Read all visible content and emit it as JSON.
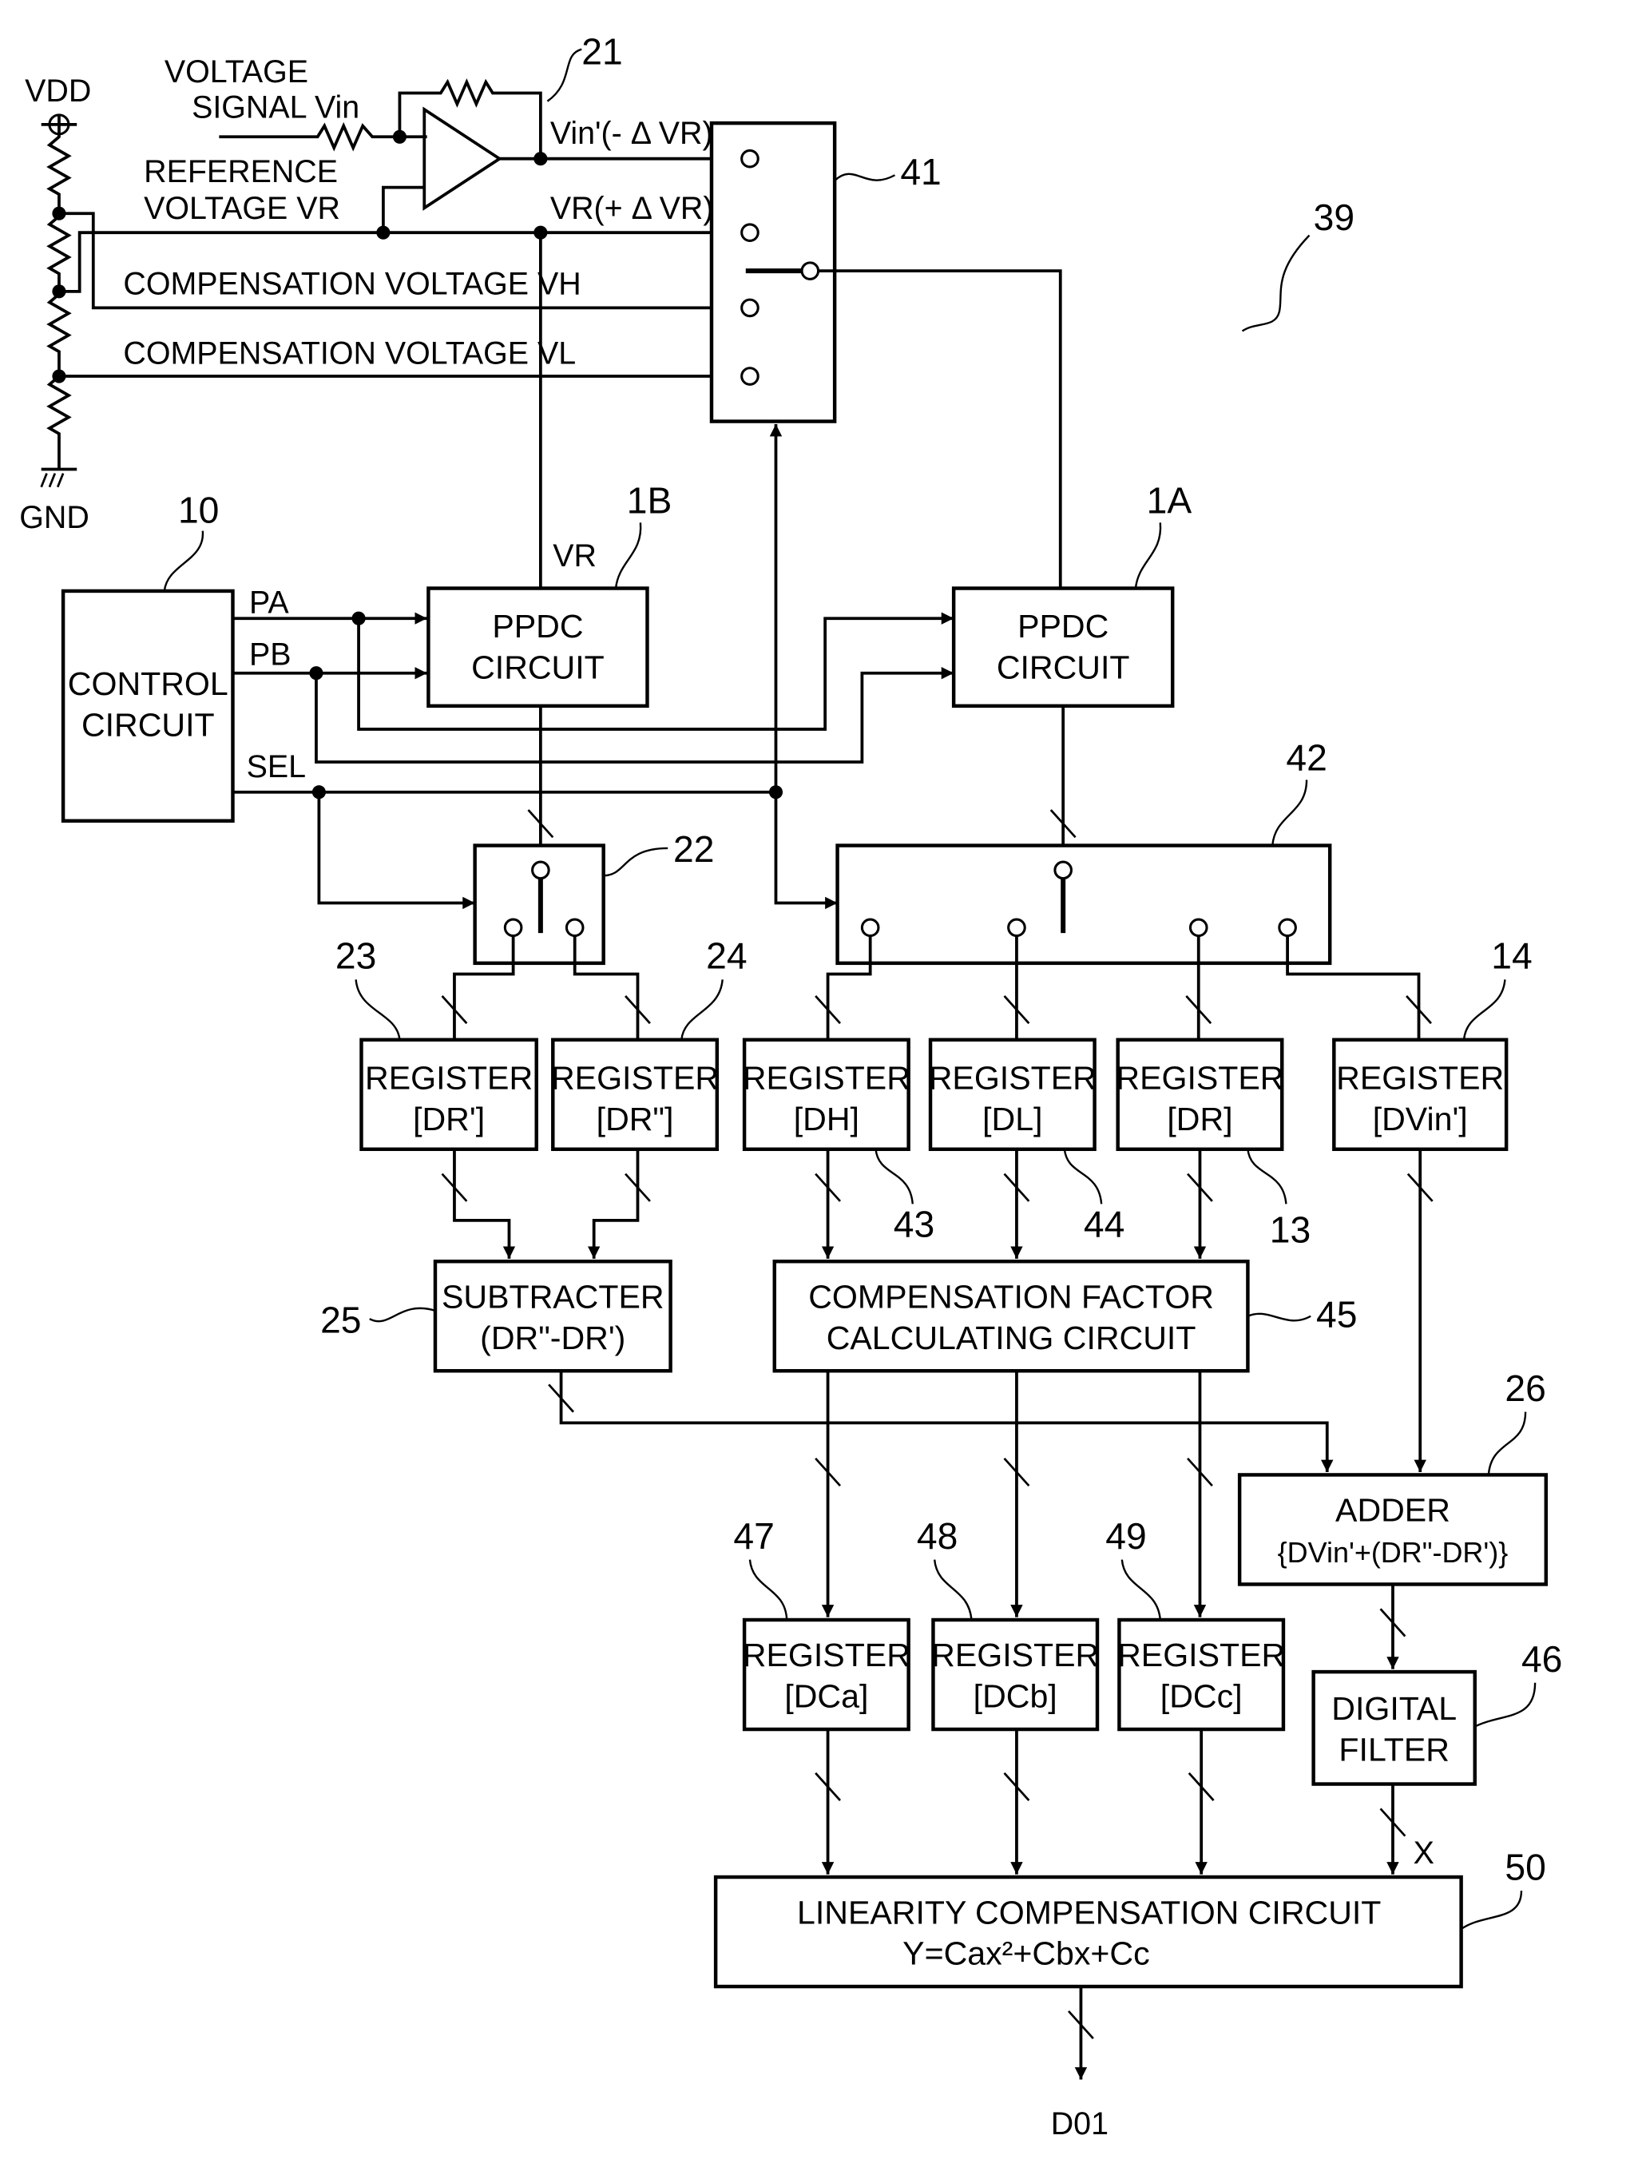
{
  "figure": {
    "figure_ref": "39",
    "power": {
      "vdd_label": "VDD",
      "gnd_label": "GND"
    },
    "signals": {
      "voltage_signal_line1": "VOLTAGE",
      "voltage_signal_line2": "SIGNAL Vin",
      "reference_voltage_line1": "REFERENCE",
      "reference_voltage_line2": "VOLTAGE VR",
      "compensation_vh": "COMPENSATION VOLTAGE VH",
      "compensation_vl": "COMPENSATION VOLTAGE VL",
      "vin_prime": "Vin'(- Δ VR)",
      "vr_plus": "VR(+ Δ VR)",
      "vr": "VR",
      "pa": "PA",
      "pb": "PB",
      "sel": "SEL",
      "x": "X",
      "output": "D01"
    },
    "blocks": {
      "amplifier": {
        "ref": "21"
      },
      "selector_41": {
        "ref": "41"
      },
      "control": {
        "ref": "10",
        "line1": "CONTROL",
        "line2": "CIRCUIT"
      },
      "ppdc_1b": {
        "ref": "1B",
        "line1": "PPDC",
        "line2": "CIRCUIT"
      },
      "ppdc_1a": {
        "ref": "1A",
        "line1": "PPDC",
        "line2": "CIRCUIT"
      },
      "switch_22": {
        "ref": "22"
      },
      "switch_42": {
        "ref": "42"
      },
      "reg_23": {
        "ref": "23",
        "line1": "REGISTER",
        "line2": "[DR']"
      },
      "reg_24": {
        "ref": "24",
        "line1": "REGISTER",
        "line2": "[DR\"]"
      },
      "reg_43": {
        "ref": "43",
        "line1": "REGISTER",
        "line2": "[DH]"
      },
      "reg_44": {
        "ref": "44",
        "line1": "REGISTER",
        "line2": "[DL]"
      },
      "reg_13": {
        "ref": "13",
        "line1": "REGISTER",
        "line2": "[DR]"
      },
      "reg_14": {
        "ref": "14",
        "line1": "REGISTER",
        "line2": "[DVin']"
      },
      "subtracter": {
        "ref": "25",
        "line1": "SUBTRACTER",
        "line2": "(DR\"-DR')"
      },
      "comp_factor": {
        "ref": "45",
        "line1": "COMPENSATION FACTOR",
        "line2": "CALCULATING CIRCUIT"
      },
      "adder": {
        "ref": "26",
        "line1": "ADDER",
        "line2": "{DVin'+(DR\"-DR')}"
      },
      "reg_47": {
        "ref": "47",
        "line1": "REGISTER",
        "line2": "[DCa]"
      },
      "reg_48": {
        "ref": "48",
        "line1": "REGISTER",
        "line2": "[DCb]"
      },
      "reg_49": {
        "ref": "49",
        "line1": "REGISTER",
        "line2": "[DCc]"
      },
      "digital_filter": {
        "ref": "46",
        "line1": "DIGITAL",
        "line2": "FILTER"
      },
      "linearity": {
        "ref": "50",
        "line1": "LINEARITY COMPENSATION CIRCUIT",
        "line2": "Y=Cax²+Cbx+Cc"
      }
    }
  }
}
